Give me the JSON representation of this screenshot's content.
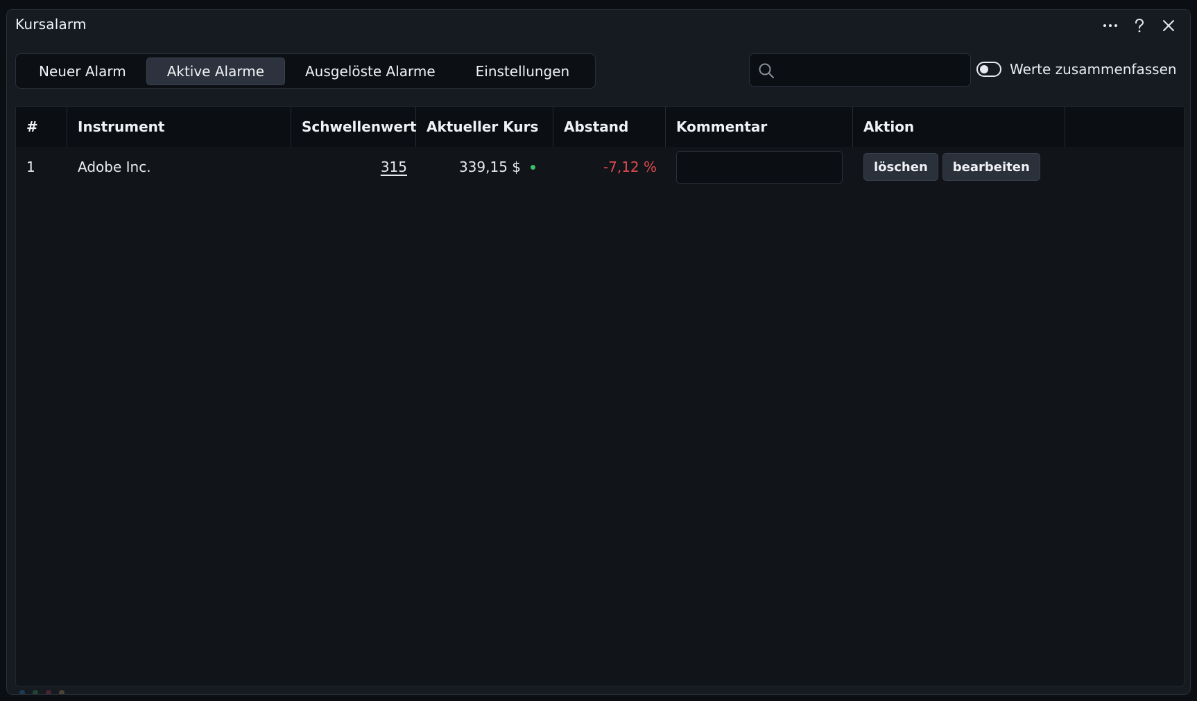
{
  "window": {
    "title": "Kursalarm",
    "actions": [
      {
        "name": "more-icon"
      },
      {
        "name": "help-icon"
      },
      {
        "name": "close-icon"
      }
    ]
  },
  "tabs": [
    {
      "label": "Neuer Alarm",
      "active": false
    },
    {
      "label": "Aktive Alarme",
      "active": true
    },
    {
      "label": "Ausgelöste Alarme",
      "active": false
    },
    {
      "label": "Einstellungen",
      "active": false
    }
  ],
  "search": {
    "value": "",
    "placeholder": "",
    "icon": "search-icon"
  },
  "toggle": {
    "label": "Werte zusammenfassen",
    "on": false
  },
  "table": {
    "columns": [
      "#",
      "Instrument",
      "Schwellenwert",
      "Aktueller Kurs",
      "Abstand",
      "Kommentar",
      "Aktion"
    ],
    "rows": [
      {
        "index": "1",
        "instrument": "Adobe Inc.",
        "threshold": "315",
        "current_price": "339,15 $",
        "distance": "-7,12 %",
        "comment": "",
        "actions": {
          "delete": "löschen",
          "edit": "bearbeiten"
        }
      }
    ]
  },
  "colors": {
    "negative": "#e04a50",
    "live_dot": "#3cc26a",
    "active_tab": "#2c333e"
  }
}
